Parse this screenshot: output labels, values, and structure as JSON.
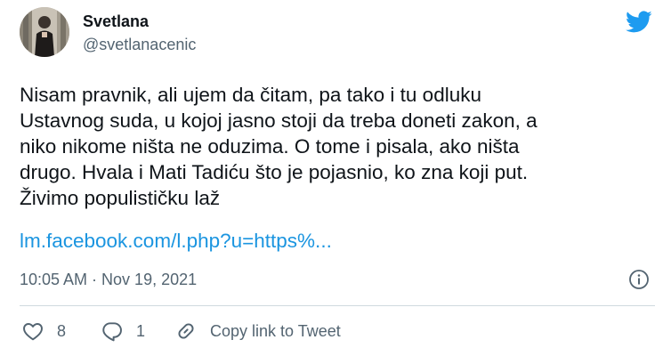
{
  "author": {
    "display_name": "Svetlana",
    "handle": "@svetlanacenic"
  },
  "tweet": {
    "text": "Nisam pravnik, ali ujem da čitam, pa tako i tu odluku\nUstavnog suda, u kojoj jasno stoji da treba doneti zakon, a\nniko nikome ništa ne oduzima. O tome i pisala, ako ništa\ndrugo. Hvala i Mati Tadiću što je pojasnio, ko zna koji put.\nŽivimo populističku laž",
    "link": "lm.facebook.com/l.php?u=https%...",
    "timestamp": "10:05 AM · Nov 19, 2021"
  },
  "actions": {
    "like_count": "8",
    "reply_count": "1",
    "copy_link_label": "Copy link to Tweet"
  },
  "colors": {
    "brand_blue": "#1d9bf0",
    "link_blue": "#1b95e0",
    "secondary_text": "#536471"
  },
  "icons": [
    "twitter-bird-icon",
    "info-icon",
    "heart-icon",
    "reply-icon",
    "link-icon"
  ]
}
